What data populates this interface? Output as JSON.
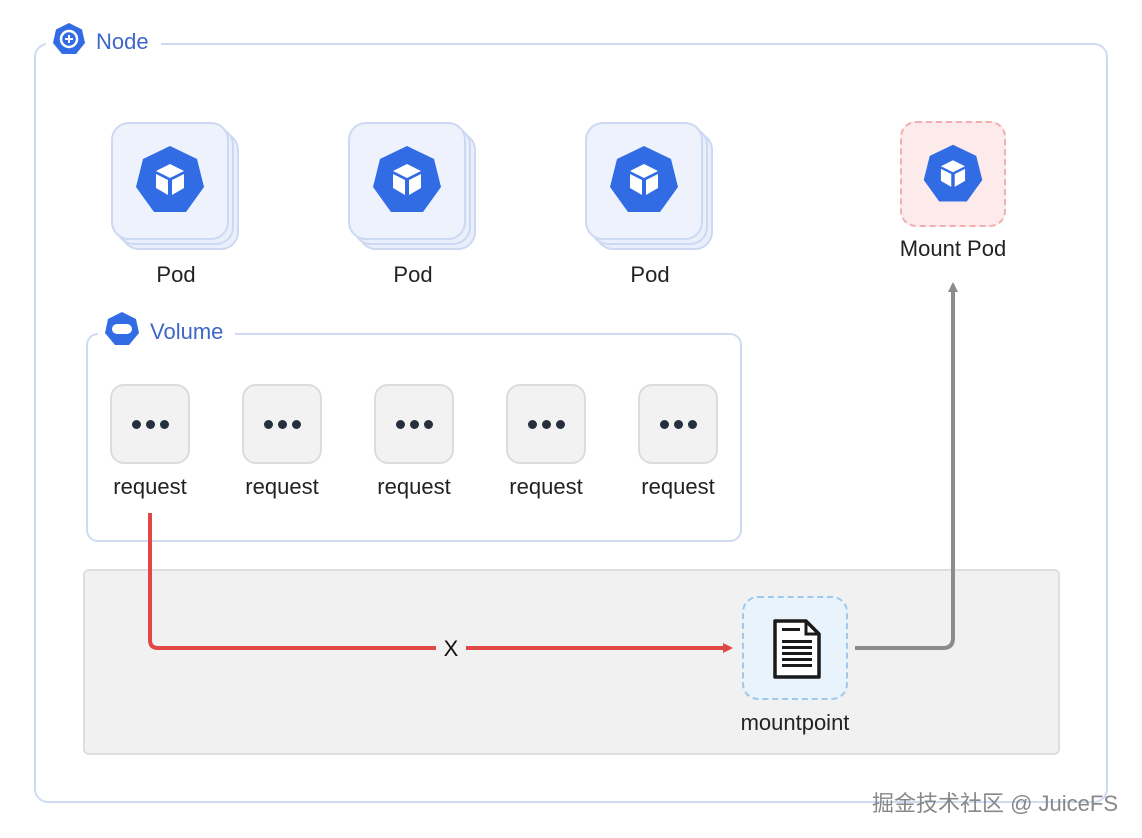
{
  "node": {
    "label": "Node"
  },
  "pods": [
    {
      "label": "Pod"
    },
    {
      "label": "Pod"
    },
    {
      "label": "Pod"
    }
  ],
  "mount_pod": {
    "label": "Mount Pod"
  },
  "volume": {
    "label": "Volume",
    "requests": [
      {
        "label": "request"
      },
      {
        "label": "request"
      },
      {
        "label": "request"
      },
      {
        "label": "request"
      },
      {
        "label": "request"
      }
    ]
  },
  "mountpoint": {
    "label": "mountpoint"
  },
  "edge_failed": {
    "label": "X",
    "color": "#e04848"
  },
  "edge_mount": {
    "color": "#8c8c8c"
  },
  "colors": {
    "accent": "#3f66c9",
    "kube_blue": "#326ce5",
    "border": "#cfdbf1"
  },
  "icons": {
    "node": "kubernetes-node-icon",
    "pod": "kubernetes-pod-icon",
    "volume": "kubernetes-volume-icon",
    "request": "more-dots-icon",
    "mountpoint": "document-icon"
  },
  "watermark": "掘金技术社区 @ JuiceFS"
}
